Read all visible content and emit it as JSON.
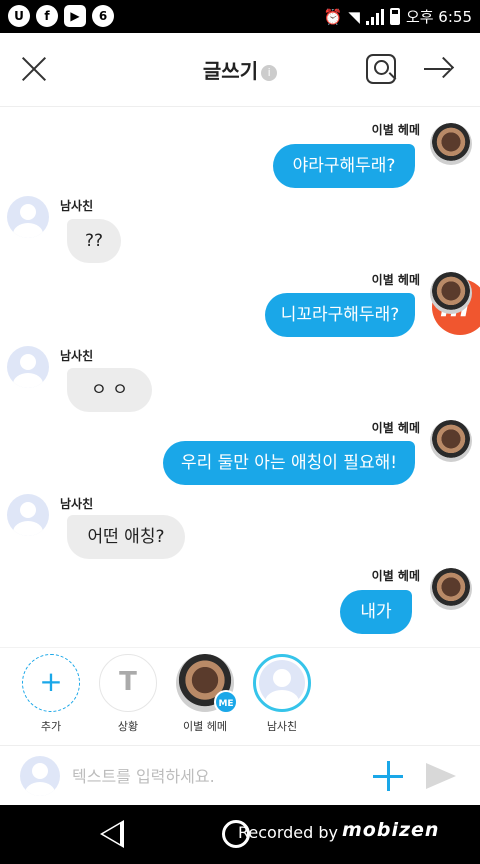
{
  "status_bar": {
    "left_icons": [
      "U",
      "f",
      "▶",
      "6"
    ],
    "right_text": "오후 6:55"
  },
  "header": {
    "title": "글쓰기",
    "info_icon": "i"
  },
  "messages": [
    {
      "sender": "이별 헤메",
      "side": "me",
      "text": "야라구해두래?"
    },
    {
      "sender": "남사친",
      "side": "them",
      "text": "??"
    },
    {
      "sender": "이별 헤메",
      "side": "me",
      "text": "니꼬라구해두래?"
    },
    {
      "sender": "남사친",
      "side": "them",
      "text": "ㅇ ㅇ"
    },
    {
      "sender": "이별 헤메",
      "side": "me",
      "text": "우리 둘만 아는 애칭이 필요해!"
    },
    {
      "sender": "남사친",
      "side": "them",
      "text": "어떤 애칭?"
    },
    {
      "sender": "이별 헤메",
      "side": "me",
      "text": "내가"
    }
  ],
  "floating_button": {
    "label": "m"
  },
  "speakers": [
    {
      "label": "추가",
      "glyph": "+"
    },
    {
      "label": "상황",
      "glyph": "T"
    },
    {
      "label": "이별 헤메",
      "badge": "ME"
    },
    {
      "label": "남사친"
    }
  ],
  "input": {
    "placeholder": "텍스트를 입력하세요."
  },
  "nav": {
    "recorded_text": "Recorded by",
    "recorder_brand": "mobizen"
  },
  "colors": {
    "accent": "#1aa7e8",
    "bubble_other": "#ececec",
    "floating": "#f0562f"
  }
}
